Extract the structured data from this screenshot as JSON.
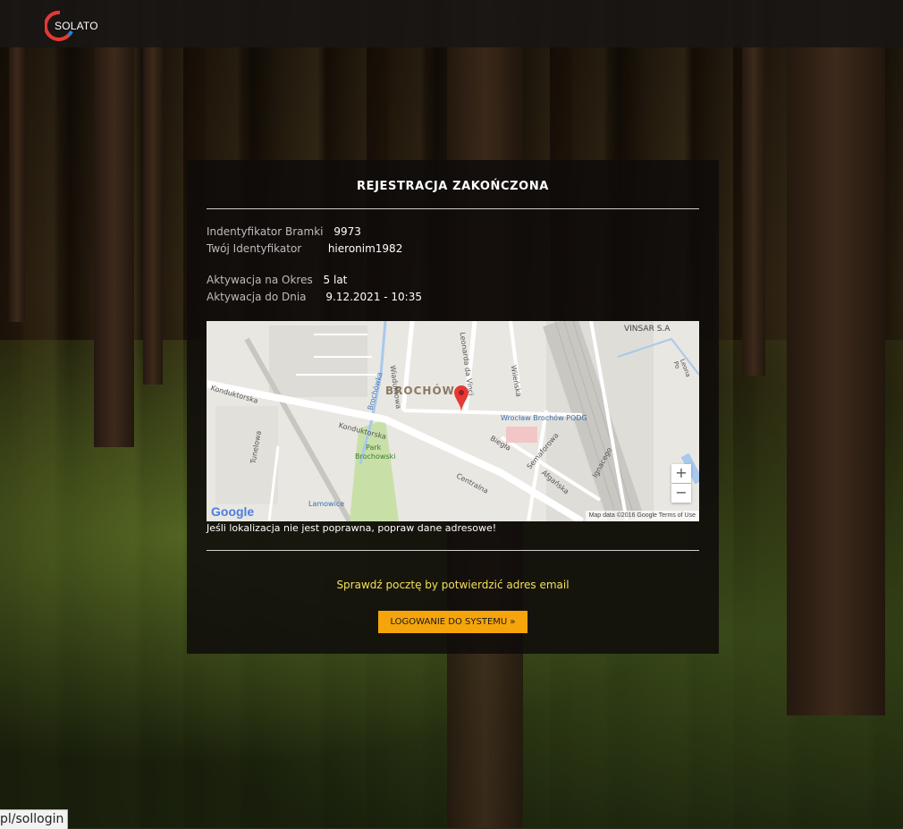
{
  "brand": {
    "name": "SOLATO",
    "ring_colors": [
      "#e53935",
      "#1e88e5"
    ]
  },
  "registration": {
    "title": "REJESTRACJA ZAKOŃCZONA",
    "gateway_id_label": "Indentyfikator Bramki",
    "gateway_id_value": "9973",
    "user_id_label": "Twój Identyfikator",
    "user_id_value": "hieronim1982",
    "period_label": "Aktywacja na Okres",
    "period_value": "5 lat",
    "until_label": "Aktywacja do Dnia",
    "until_value": "9.12.2021 - 10:35"
  },
  "map": {
    "labels": {
      "district": "BROCHÓW",
      "konduktorska_1": "Konduktorska",
      "konduktorska_2": "Konduktorska",
      "park": "Park",
      "park2": "Brochowski",
      "wiadukt": "Wiaduktowa",
      "leonarda": "Leonarda da Vinci",
      "wilenska": "Wileńska",
      "biegla": "Biegła",
      "semaforowa": "Semaforowa",
      "afganska": "Afgańska",
      "centralna": "Centralna",
      "ignacego": "Ignacego",
      "tunelowa": "Tunelowa",
      "brochowka": "Brochówka",
      "station": "Wrocław Brochów PODG",
      "lamowice": "Lamowice",
      "vinsar": "VINSAR S.A",
      "leona": "Leona Po"
    },
    "zoom_in": "+",
    "zoom_out": "−",
    "google": "Google",
    "attribution": "Map data ©2016 Google    Terms of Use",
    "note": "Jeśli lokalizacja nie jest poprawna, popraw dane adresowe!"
  },
  "email_note": "Sprawdź pocztę by potwierdzić adres email",
  "login_button": "LOGOWANIE DO SYSTEMU »",
  "status_bar_url": "pl/sollogin"
}
